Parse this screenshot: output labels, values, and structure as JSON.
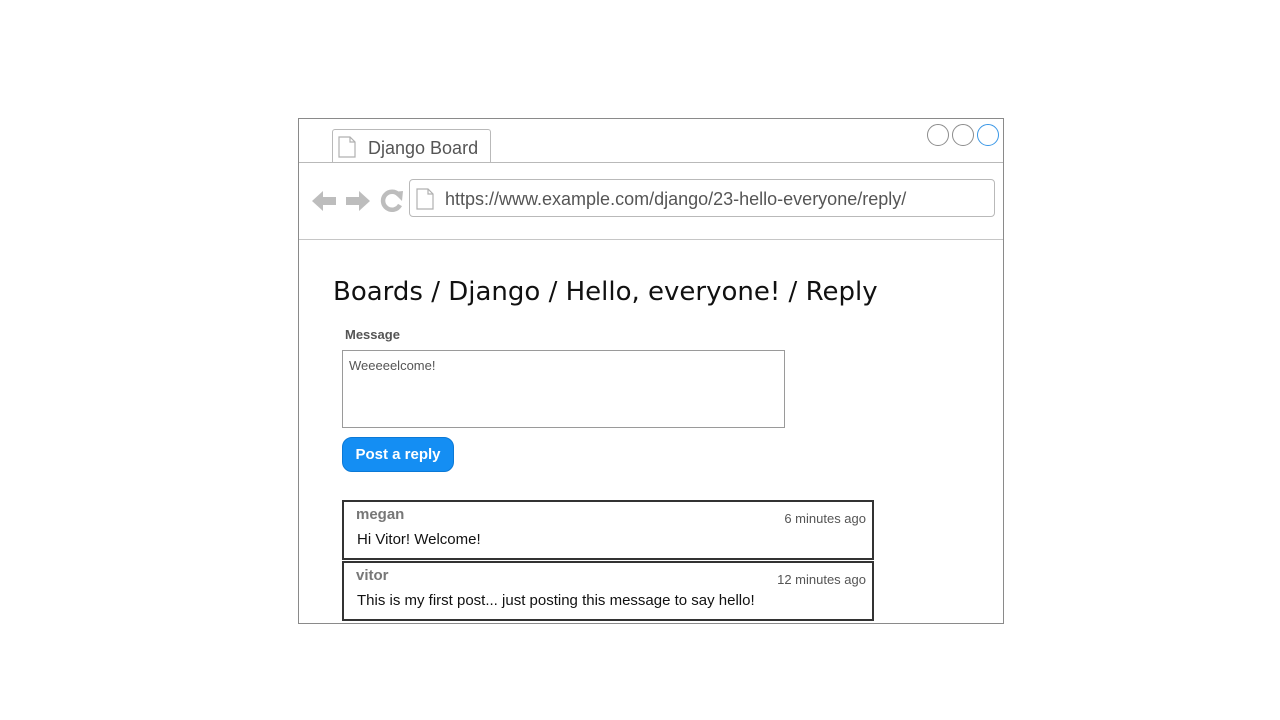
{
  "tab": {
    "title": "Django Board"
  },
  "address_bar": {
    "url": "https://www.example.com/django/23-hello-everyone/reply/"
  },
  "page": {
    "breadcrumb": "Boards / Django / Hello, everyone! / Reply"
  },
  "form": {
    "message_label": "Message",
    "message_value": "Weeeeelcome!",
    "submit_label": "Post a reply",
    "submit_color": "#148ef3"
  },
  "posts": [
    {
      "author": "megan",
      "time": "6 minutes ago",
      "text": "Hi Vitor! Welcome!"
    },
    {
      "author": "vitor",
      "time": "12 minutes ago",
      "text": "This is my first post... just posting this message to say hello!"
    }
  ]
}
